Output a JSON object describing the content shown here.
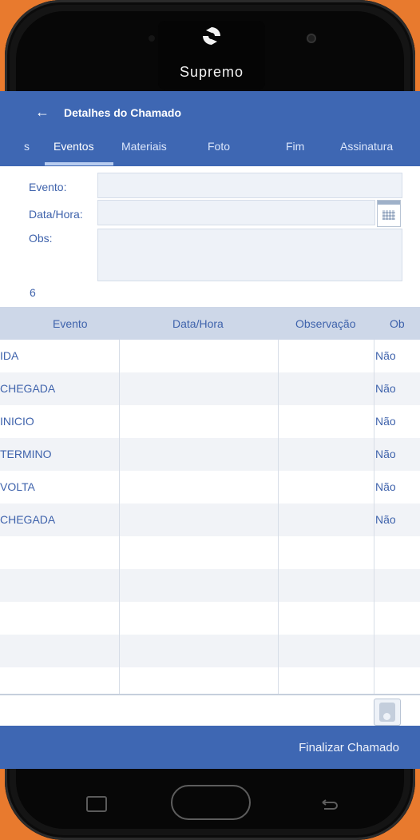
{
  "device": {
    "brand": "Supremo"
  },
  "appbar": {
    "back_icon": "arrow-left-icon",
    "back_glyph": "←",
    "title": "Detalhes do Chamado"
  },
  "tabs": [
    {
      "label": "s"
    },
    {
      "label": "Eventos",
      "active": true
    },
    {
      "label": "Materiais"
    },
    {
      "label": "Foto"
    },
    {
      "label": "Fim"
    },
    {
      "label": "Assinatura"
    }
  ],
  "form": {
    "evento_label": "Evento:",
    "evento_value": "",
    "datahora_label": "Data/Hora:",
    "datahora_value": "",
    "obs_label": "Obs:",
    "obs_value": ""
  },
  "count": "6",
  "table": {
    "columns": [
      "Evento",
      "Data/Hora",
      "Observação",
      "Ob"
    ],
    "rows": [
      {
        "evento": "IDA",
        "datahora": "",
        "observacao": "",
        "ob": "Não"
      },
      {
        "evento": "CHEGADA",
        "datahora": "",
        "observacao": "",
        "ob": "Não"
      },
      {
        "evento": "INICIO",
        "datahora": "",
        "observacao": "",
        "ob": "Não"
      },
      {
        "evento": "TERMINO",
        "datahora": "",
        "observacao": "",
        "ob": "Não"
      },
      {
        "evento": "VOLTA",
        "datahora": "",
        "observacao": "",
        "ob": "Não"
      },
      {
        "evento": "CHEGADA",
        "datahora": "",
        "observacao": "",
        "ob": "Não"
      }
    ]
  },
  "footer": {
    "finalize_label": "Finalizar Chamado"
  },
  "colors": {
    "primary": "#3e67b3",
    "header_row": "#cdd7e8",
    "text": "#3f63ac",
    "frame": "#e87a2e"
  }
}
